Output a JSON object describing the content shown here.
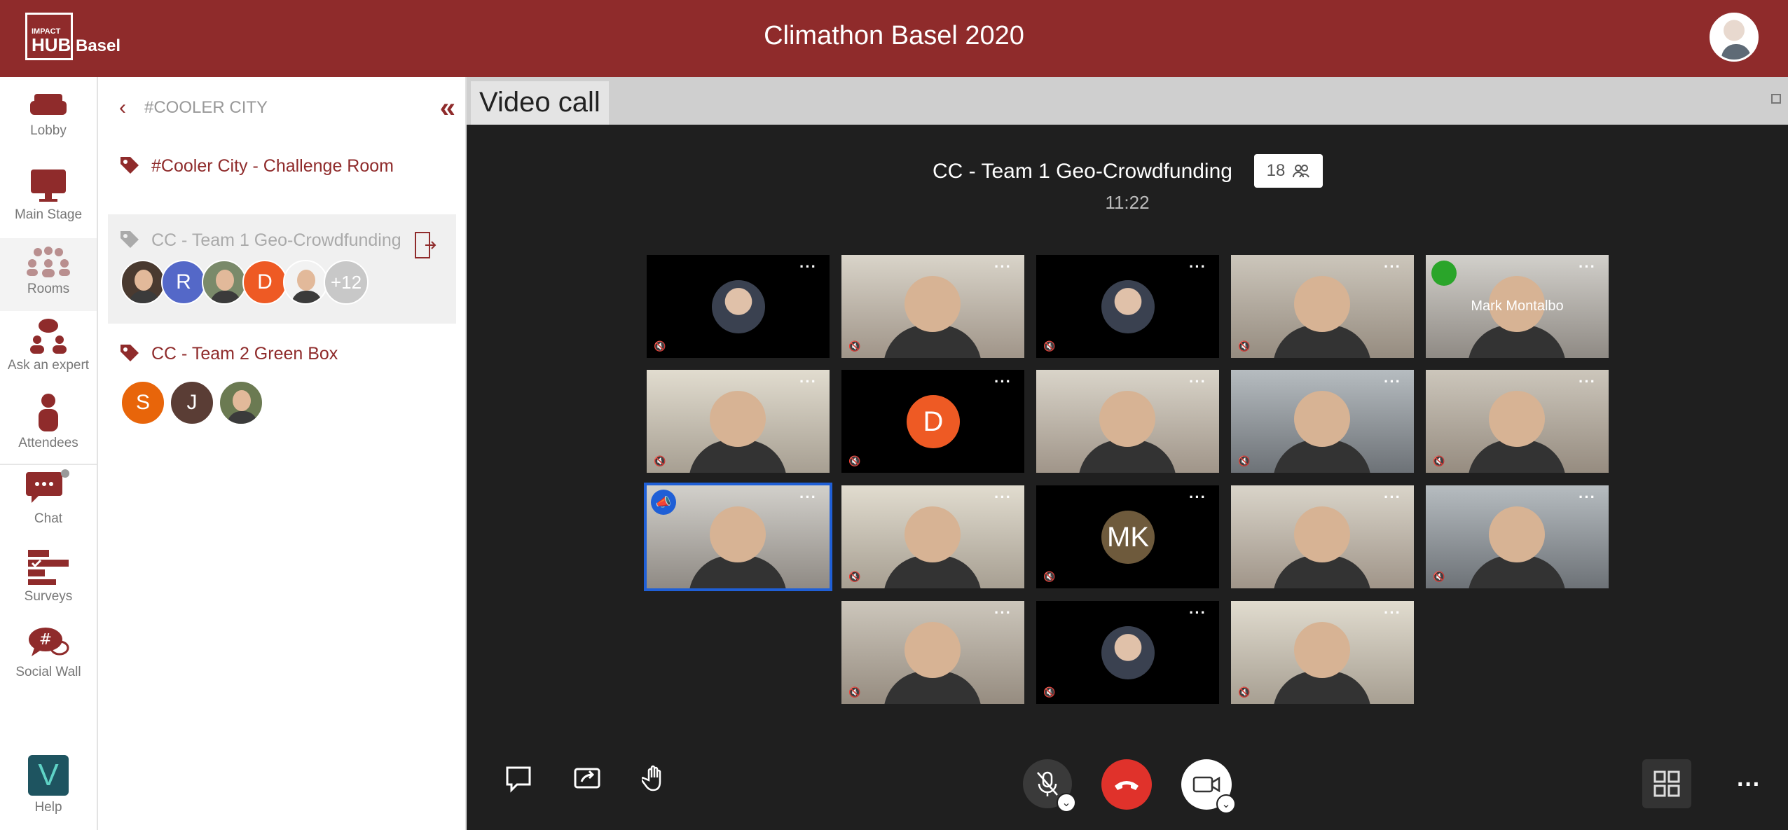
{
  "header": {
    "logo_small": "IMPACT",
    "logo_big": "HUB",
    "logo_city": "Basel",
    "title": "Climathon Basel 2020"
  },
  "leftnav": {
    "items": [
      {
        "label": "Lobby",
        "icon": "sofa-icon"
      },
      {
        "label": "Main Stage",
        "icon": "monitor-icon"
      },
      {
        "label": "Rooms",
        "icon": "people-group-icon"
      },
      {
        "label": "Ask an expert",
        "icon": "expert-icon"
      },
      {
        "label": "Attendees",
        "icon": "person-icon"
      },
      {
        "label": "Chat",
        "icon": "chat-icon"
      },
      {
        "label": "Surveys",
        "icon": "survey-icon"
      },
      {
        "label": "Social Wall",
        "icon": "hashtag-bubble-icon"
      },
      {
        "label": "Help",
        "icon": "help-logo-icon"
      }
    ],
    "help_glyph": "V"
  },
  "rooms_panel": {
    "title": "#COOLER CITY",
    "rooms": [
      {
        "name": "#Cooler City - Challenge Room"
      },
      {
        "name": "CC - Team 1 Geo-Crowdfunding",
        "avatars": [
          "",
          "R",
          "",
          "D",
          "",
          "+12"
        ]
      },
      {
        "name": "CC - Team 2 Green Box",
        "avatars": [
          "S",
          "J",
          ""
        ]
      }
    ]
  },
  "video": {
    "tab_label": "Video call",
    "room_title": "CC - Team 1 Geo-Crowdfunding",
    "participant_count": "18",
    "timer": "11:22",
    "tiles": [
      {
        "kind": "avatar",
        "muted": true
      },
      {
        "kind": "cam",
        "muted": true
      },
      {
        "kind": "avatar",
        "muted": true
      },
      {
        "kind": "cam",
        "muted": true
      },
      {
        "kind": "cam",
        "name": "Mark Montalbo"
      },
      {
        "kind": "cam",
        "muted": true
      },
      {
        "kind": "initial",
        "initial": "D",
        "muted": true
      },
      {
        "kind": "cam"
      },
      {
        "kind": "cam",
        "muted": true
      },
      {
        "kind": "cam",
        "muted": true
      },
      {
        "kind": "cam",
        "speaker": true
      },
      {
        "kind": "cam",
        "muted": true
      },
      {
        "kind": "initial",
        "initial": "MK",
        "muted": true
      },
      {
        "kind": "cam"
      },
      {
        "kind": "cam",
        "muted": true
      },
      {
        "kind": "cam",
        "muted": true
      },
      {
        "kind": "avatar",
        "muted": true
      },
      {
        "kind": "cam",
        "muted": true
      }
    ]
  }
}
